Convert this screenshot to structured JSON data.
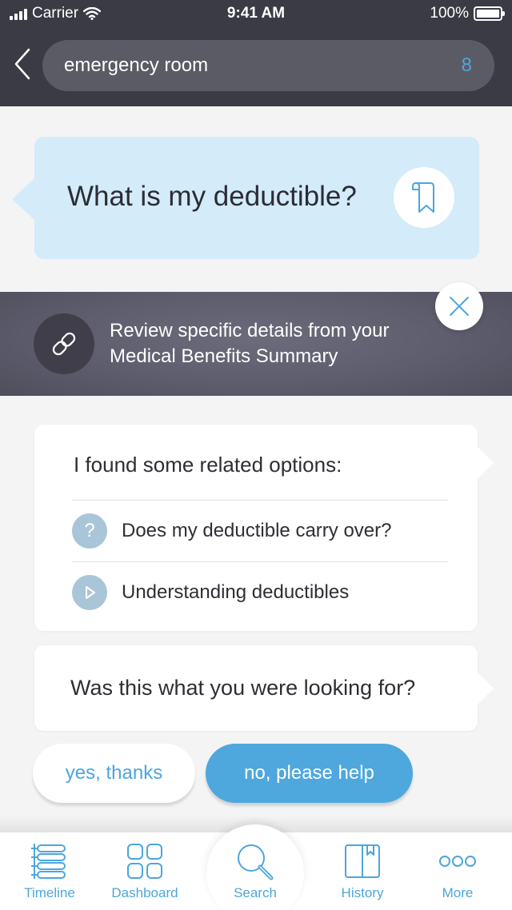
{
  "status_bar": {
    "carrier": "Carrier",
    "time": "9:41 AM",
    "battery": "100%"
  },
  "search": {
    "query": "emergency room",
    "count": "8"
  },
  "question": {
    "text": "What is my deductible?"
  },
  "banner": {
    "line1": "Review specific details from your",
    "line2": "Medical Benefits Summary"
  },
  "options": {
    "title": "I found some related options:",
    "items": [
      {
        "label": "Does my deductible carry over?",
        "icon": "question-icon"
      },
      {
        "label": "Understanding deductibles",
        "icon": "play-icon"
      }
    ]
  },
  "confirm": {
    "text": "Was this what you were looking for?",
    "yes_label": "yes, thanks",
    "no_label": "no, please help"
  },
  "nav": {
    "items": [
      {
        "label": "Timeline",
        "icon": "timeline-icon"
      },
      {
        "label": "Dashboard",
        "icon": "dashboard-icon"
      },
      {
        "label": "Search",
        "icon": "search-icon"
      },
      {
        "label": "History",
        "icon": "history-icon"
      },
      {
        "label": "More",
        "icon": "more-icon"
      }
    ]
  },
  "colors": {
    "header_bg": "#3b3b45",
    "accent": "#4ca6dc",
    "question_bubble": "#d4ebfa",
    "option_icon_bg": "#a9c6d8"
  }
}
